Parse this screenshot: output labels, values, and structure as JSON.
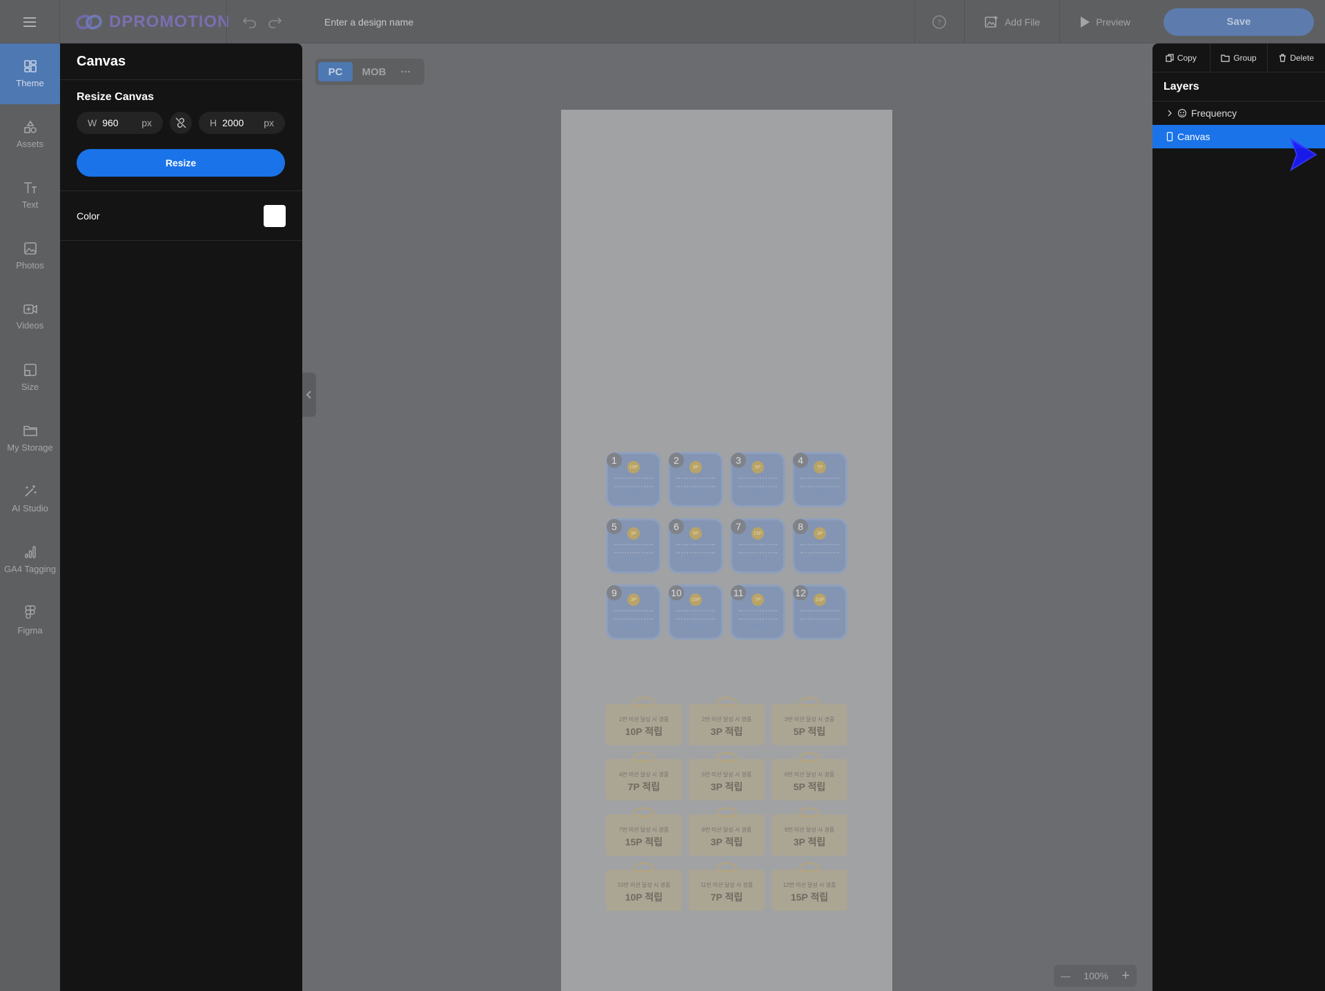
{
  "topbar": {
    "logo_text": "DPROMOTION",
    "design_name_placeholder": "Enter a design name",
    "add_file_label": "Add File",
    "preview_label": "Preview",
    "save_label": "Save"
  },
  "rail": {
    "items": [
      {
        "label": "Theme",
        "icon": "theme-icon"
      },
      {
        "label": "Assets",
        "icon": "shapes-icon"
      },
      {
        "label": "Text",
        "icon": "text-icon"
      },
      {
        "label": "Photos",
        "icon": "image-icon"
      },
      {
        "label": "Videos",
        "icon": "video-icon"
      },
      {
        "label": "Size",
        "icon": "size-icon"
      },
      {
        "label": "My Storage",
        "icon": "folder-icon"
      },
      {
        "label": "AI Studio",
        "icon": "magic-wand-icon"
      },
      {
        "label": "GA4 Tagging",
        "icon": "analytics-icon"
      },
      {
        "label": "Figma",
        "icon": "figma-icon"
      }
    ]
  },
  "panel": {
    "title": "Canvas",
    "resize_title": "Resize Canvas",
    "width_label": "W",
    "width_value": "960",
    "height_label": "H",
    "height_value": "2000",
    "unit": "px",
    "resize_button": "Resize",
    "color_label": "Color",
    "color_value": "#ffffff"
  },
  "device": {
    "pc": "PC",
    "mob": "MOB",
    "more": "···"
  },
  "canvas": {
    "missions": [
      {
        "num": "1",
        "coin": "10P",
        "click": "Click !"
      },
      {
        "num": "2",
        "coin": "3P",
        "click": "Click !"
      },
      {
        "num": "3",
        "coin": "5P",
        "click": "Click !"
      },
      {
        "num": "4",
        "coin": "7P",
        "click": "Click !"
      },
      {
        "num": "5",
        "coin": "3P",
        "click": "Click !"
      },
      {
        "num": "6",
        "coin": "5P",
        "click": "Click !"
      },
      {
        "num": "7",
        "coin": "15P",
        "click": "Click !"
      },
      {
        "num": "8",
        "coin": "3P",
        "click": "Click !"
      },
      {
        "num": "9",
        "coin": "3P",
        "click": "Click !"
      },
      {
        "num": "10",
        "coin": "10P",
        "click": "Click !"
      },
      {
        "num": "11",
        "coin": "7P",
        "click": "Click !"
      },
      {
        "num": "12",
        "coin": "15P",
        "click": "Click !"
      }
    ],
    "rewards": [
      {
        "small": "1번 미션 달성 시 경품",
        "big": "10P 적립"
      },
      {
        "small": "2번 미션 달성 시 경품",
        "big": "3P 적립"
      },
      {
        "small": "3번 미션 달성 시 경품",
        "big": "5P 적립"
      },
      {
        "small": "4번 미션 달성 시 경품",
        "big": "7P 적립"
      },
      {
        "small": "5번 미션 달성 시 경품",
        "big": "3P 적립"
      },
      {
        "small": "6번 미션 달성 시 경품",
        "big": "5P 적립"
      },
      {
        "small": "7번 미션 달성 시 경품",
        "big": "15P 적립"
      },
      {
        "small": "8번 미션 달성 시 경품",
        "big": "3P 적립"
      },
      {
        "small": "9번 미션 달성 시 경품",
        "big": "3P 적립"
      },
      {
        "small": "10번 미션 달성 시 경품",
        "big": "10P 적립"
      },
      {
        "small": "11번 미션 달성 시 경품",
        "big": "7P 적립"
      },
      {
        "small": "12번 미션 달성 시 경품",
        "big": "15P 적립"
      }
    ]
  },
  "zoom": {
    "value": "100%"
  },
  "rpanel": {
    "copy": "Copy",
    "group": "Group",
    "delete": "Delete",
    "layers_title": "Layers",
    "layers": [
      {
        "label": "Frequency",
        "icon": "frequency-icon",
        "selected": false
      },
      {
        "label": "Canvas",
        "icon": "canvas-icon",
        "selected": true
      }
    ]
  },
  "colors": {
    "accent": "#1a73e8",
    "panel_bg": "#141414",
    "overlay": "#6b6c6f"
  }
}
